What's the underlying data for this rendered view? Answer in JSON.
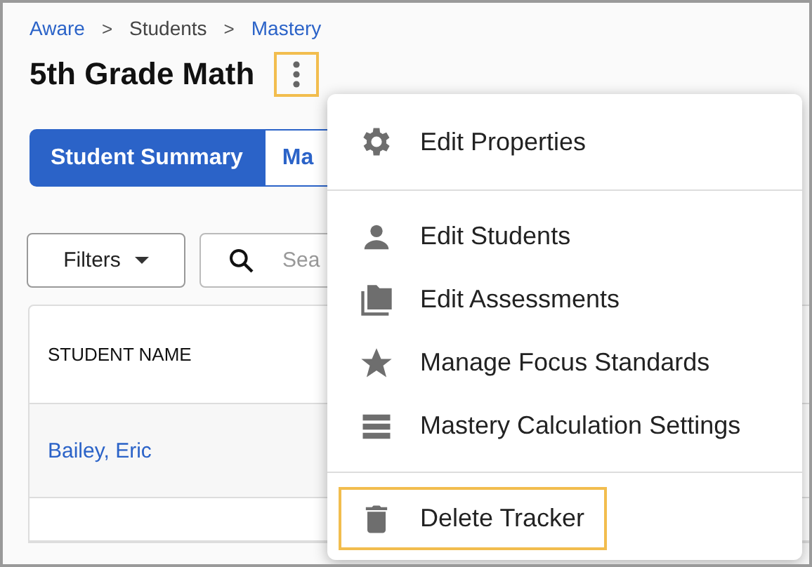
{
  "breadcrumb": [
    {
      "label": "Aware",
      "link": true
    },
    {
      "label": "Students",
      "link": false
    },
    {
      "label": "Mastery",
      "link": true
    }
  ],
  "breadcrumb_separator": ">",
  "title": "5th Grade Math",
  "more_button": {
    "highlighted": true
  },
  "tabs": [
    {
      "label": "Student Summary",
      "selected": true
    },
    {
      "label": "Ma",
      "selected": false
    }
  ],
  "filters_button": {
    "label": "Filters"
  },
  "search": {
    "placeholder": "Sea"
  },
  "table": {
    "columns": [
      "STUDENT NAME"
    ],
    "rows": [
      [
        "Bailey, Eric"
      ]
    ]
  },
  "menu": {
    "groups": [
      [
        {
          "label": "Edit Properties",
          "kind": "properties",
          "highlighted": false
        }
      ],
      [
        {
          "label": "Edit Students",
          "kind": "students",
          "highlighted": false
        },
        {
          "label": "Edit Assessments",
          "kind": "assessments",
          "highlighted": false
        },
        {
          "label": "Manage Focus Standards",
          "kind": "standards",
          "highlighted": false
        },
        {
          "label": "Mastery Calculation Settings",
          "kind": "calculation",
          "highlighted": false
        }
      ],
      [
        {
          "label": "Delete Tracker",
          "kind": "delete",
          "highlighted": true
        }
      ]
    ]
  }
}
